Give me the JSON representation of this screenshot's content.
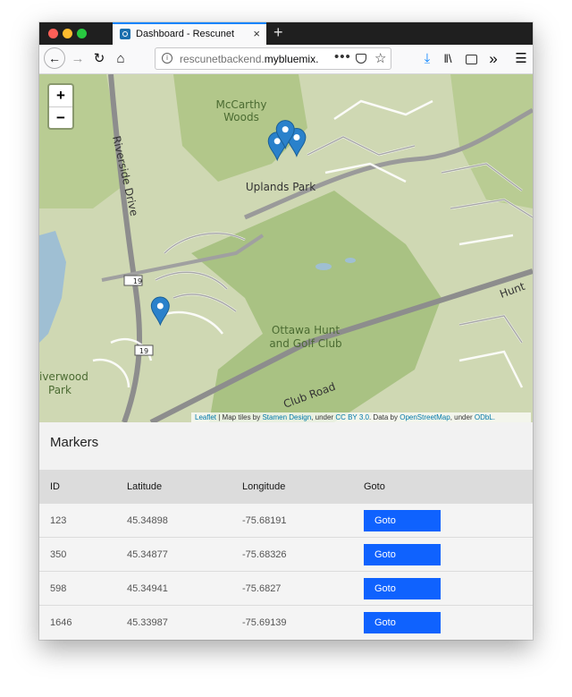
{
  "browser": {
    "tab_title": "Dashboard - Rescunet",
    "tab_close_glyph": "×",
    "new_tab_glyph": "+",
    "url_host": "rescunetbackend.",
    "url_domain": "mybluemix.",
    "toolbar_icons": [
      "back-icon",
      "forward-icon",
      "reload-icon",
      "home-icon",
      "info-icon",
      "more-icon",
      "pocket-icon",
      "star-icon",
      "download-icon",
      "library-icon",
      "sidebar-icon",
      "overflow-icon",
      "menu-icon"
    ],
    "accent": "#0a84ff"
  },
  "map": {
    "zoom_in": "+",
    "zoom_out": "−",
    "labels": {
      "mccarthy_1": "McCarthy",
      "mccarthy_2": "Woods",
      "riverside": "Riverside Drive",
      "uplands": "Uplands Park",
      "ottawa_hunt_1": "Ottawa Hunt",
      "ottawa_hunt_2": "and Golf Club",
      "riverwood_1": "iverwood",
      "riverwood_2": "Park",
      "route_1": "19",
      "route_2": "19",
      "club_road": "Club Road",
      "hunt": "Hunt"
    },
    "attribution": {
      "leaflet": "Leaflet",
      "text_1": " | Map tiles by ",
      "stamen": "Stamen Design",
      "text_2": ", under ",
      "ccby": "CC BY 3.0",
      "text_3": ". Data by ",
      "osm": "OpenStreetMap",
      "text_4": ", under ",
      "odbl": "ODbL."
    },
    "marker_color": "#2a81cb"
  },
  "markers_section": {
    "title": "Markers",
    "headers": {
      "id": "ID",
      "lat": "Latitude",
      "lng": "Longitude",
      "goto": "Goto"
    },
    "rows": [
      {
        "id": "123",
        "lat": "45.34898",
        "lng": "-75.68191",
        "button": "Goto"
      },
      {
        "id": "350",
        "lat": "45.34877",
        "lng": "-75.68326",
        "button": "Goto"
      },
      {
        "id": "598",
        "lat": "45.34941",
        "lng": "-75.6827",
        "button": "Goto"
      },
      {
        "id": "1646",
        "lat": "45.33987",
        "lng": "-75.69139",
        "button": "Goto"
      }
    ],
    "button_color": "#0f62fe"
  }
}
